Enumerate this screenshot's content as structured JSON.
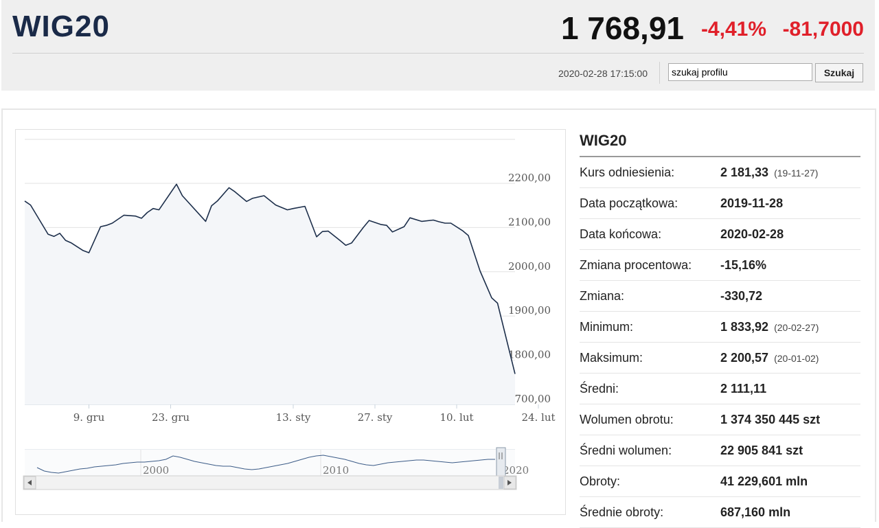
{
  "header": {
    "title": "WIG20",
    "price": "1 768,91",
    "change_pct": "-4,41%",
    "change_abs": "-81,7000",
    "datetime": "2020-02-28 17:15:00",
    "search_value": "szukaj profilu",
    "search_button": "Szukaj"
  },
  "colors": {
    "accent_negative": "#e0202a",
    "title": "#1a2a48",
    "line": "#1c2e4a"
  },
  "panel": {
    "title": "WIG20",
    "rows": [
      {
        "label": "Kurs odniesienia:",
        "value": "2 181,33",
        "note": "(19-11-27)"
      },
      {
        "label": "Data początkowa:",
        "value": "2019-11-28",
        "note": ""
      },
      {
        "label": "Data końcowa:",
        "value": "2020-02-28",
        "note": ""
      },
      {
        "label": "Zmiana procentowa:",
        "value": "-15,16%",
        "note": ""
      },
      {
        "label": "Zmiana:",
        "value": "-330,72",
        "note": ""
      },
      {
        "label": "Minimum:",
        "value": "1 833,92",
        "note": "(20-02-27)"
      },
      {
        "label": "Maksimum:",
        "value": "2 200,57",
        "note": "(20-01-02)"
      },
      {
        "label": "Średni:",
        "value": "2 111,11",
        "note": ""
      },
      {
        "label": "Wolumen obrotu:",
        "value": "1 374 350 445 szt",
        "note": ""
      },
      {
        "label": "Średni wolumen:",
        "value": "22 905 841 szt",
        "note": ""
      },
      {
        "label": "Obroty:",
        "value": "41 229,601 mln",
        "note": ""
      },
      {
        "label": "Średnie obroty:",
        "value": "687,160 mln",
        "note": ""
      }
    ]
  },
  "chart_data": {
    "type": "area",
    "title": "",
    "xlabel": "",
    "ylabel": "",
    "ylim": [
      1700,
      2200
    ],
    "y_ticks": [
      1700,
      1800,
      1900,
      2000,
      2100,
      2200
    ],
    "y_tick_labels": [
      "1700,00",
      "1800,00",
      "1900,00",
      "2000,00",
      "2100,00",
      "2200,00"
    ],
    "x_tick_labels": [
      {
        "label": "9. gru",
        "day": 11
      },
      {
        "label": "23. gru",
        "day": 25
      },
      {
        "label": "13. sty",
        "day": 46
      },
      {
        "label": "27. sty",
        "day": 60
      },
      {
        "label": "10. lut",
        "day": 74
      },
      {
        "label": "24. lut",
        "day": 88
      }
    ],
    "series": [
      {
        "name": "WIG20",
        "points": [
          [
            0,
            2160
          ],
          [
            1,
            2151
          ],
          [
            4,
            2085
          ],
          [
            5,
            2080
          ],
          [
            6,
            2087
          ],
          [
            7,
            2071
          ],
          [
            8,
            2065
          ],
          [
            10,
            2048
          ],
          [
            11,
            2043
          ],
          [
            13,
            2102
          ],
          [
            14,
            2105
          ],
          [
            15,
            2110
          ],
          [
            17,
            2128
          ],
          [
            19,
            2126
          ],
          [
            20,
            2121
          ],
          [
            21,
            2134
          ],
          [
            22,
            2143
          ],
          [
            23,
            2140
          ],
          [
            26,
            2198
          ],
          [
            27,
            2172
          ],
          [
            31,
            2114
          ],
          [
            32,
            2149
          ],
          [
            33,
            2160
          ],
          [
            35,
            2190
          ],
          [
            36,
            2181
          ],
          [
            38,
            2159
          ],
          [
            39,
            2166
          ],
          [
            41,
            2172
          ],
          [
            43,
            2151
          ],
          [
            45,
            2140
          ],
          [
            46,
            2143
          ],
          [
            48,
            2148
          ],
          [
            50,
            2079
          ],
          [
            51,
            2091
          ],
          [
            52,
            2092
          ],
          [
            54,
            2071
          ],
          [
            55,
            2060
          ],
          [
            56,
            2065
          ],
          [
            58,
            2100
          ],
          [
            59,
            2116
          ],
          [
            61,
            2107
          ],
          [
            62,
            2105
          ],
          [
            63,
            2090
          ],
          [
            65,
            2102
          ],
          [
            66,
            2122
          ],
          [
            68,
            2114
          ],
          [
            70,
            2117
          ],
          [
            71,
            2113
          ],
          [
            72,
            2110
          ],
          [
            73,
            2110
          ],
          [
            75,
            2093
          ],
          [
            76,
            2082
          ],
          [
            78,
            2002
          ],
          [
            80,
            1941
          ],
          [
            81,
            1929
          ],
          [
            84,
            1769
          ]
        ]
      }
    ],
    "navigator": {
      "x_tick_labels": [
        "2000",
        "2010",
        "2020"
      ]
    },
    "grid": true
  }
}
